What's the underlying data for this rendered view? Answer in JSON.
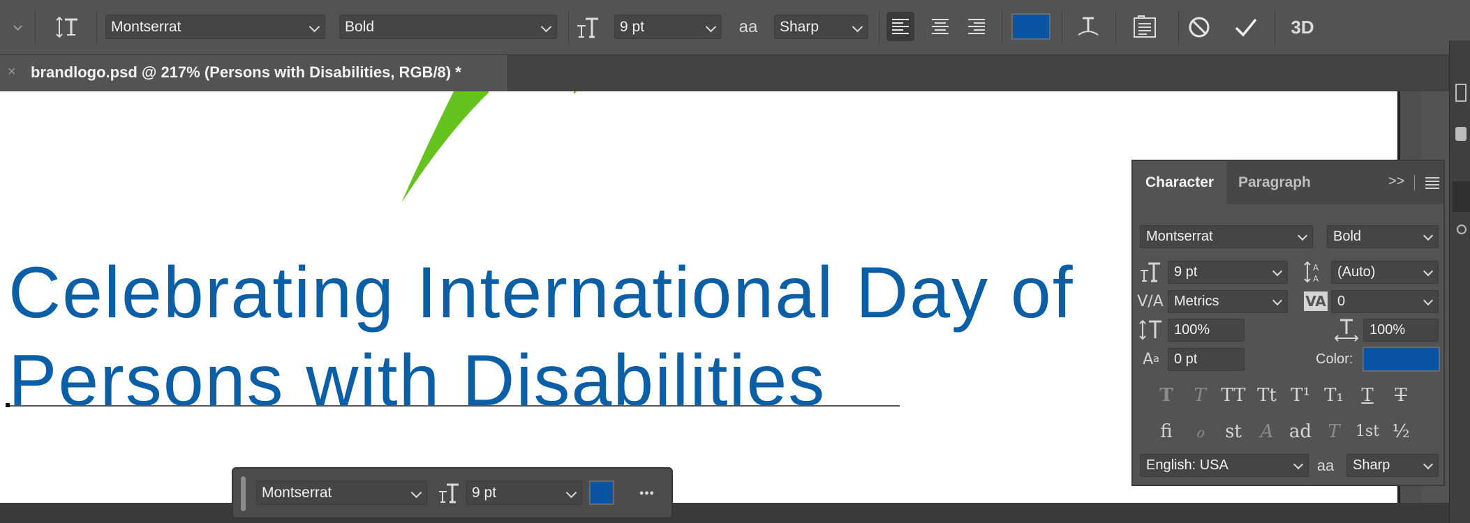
{
  "options_bar": {
    "font_family": "Montserrat",
    "font_style": "Bold",
    "font_size": "9 pt",
    "anti_alias": "Sharp",
    "text_color": "#0a55a3",
    "aa_glyph": "aa",
    "threed_label": "3D"
  },
  "document_tab": {
    "close_glyph": "×",
    "title": "brandlogo.psd @ 217% (Persons with Disabilities, RGB/8) *"
  },
  "canvas": {
    "line1": "Celebrating International Day of",
    "line2": "Persons with Disabilities",
    "text_color": "#0a5fa6",
    "leaf_color": "#66c21e"
  },
  "character_panel": {
    "tabs": [
      "Character",
      "Paragraph"
    ],
    "font_family": "Montserrat",
    "font_style": "Bold",
    "font_size": "9 pt",
    "leading": "(Auto)",
    "kerning": "Metrics",
    "tracking": "0",
    "vertical_scale": "100%",
    "horizontal_scale": "100%",
    "baseline_shift": "0 pt",
    "color_label": "Color:",
    "color_value": "#0a55a3",
    "language": "English: USA",
    "anti_alias": "Sharp",
    "aa_glyph": "aa",
    "style_buttons": [
      "T",
      "T",
      "TT",
      "Tt",
      "T¹",
      "T₁",
      "T",
      "T"
    ],
    "opentype_buttons": [
      "ﬁ",
      "ℴ",
      "st",
      "A",
      "ad",
      "T",
      "1st",
      "½"
    ]
  },
  "floating_bar": {
    "font_family": "Montserrat",
    "font_size": "9 pt",
    "more": "•••"
  }
}
